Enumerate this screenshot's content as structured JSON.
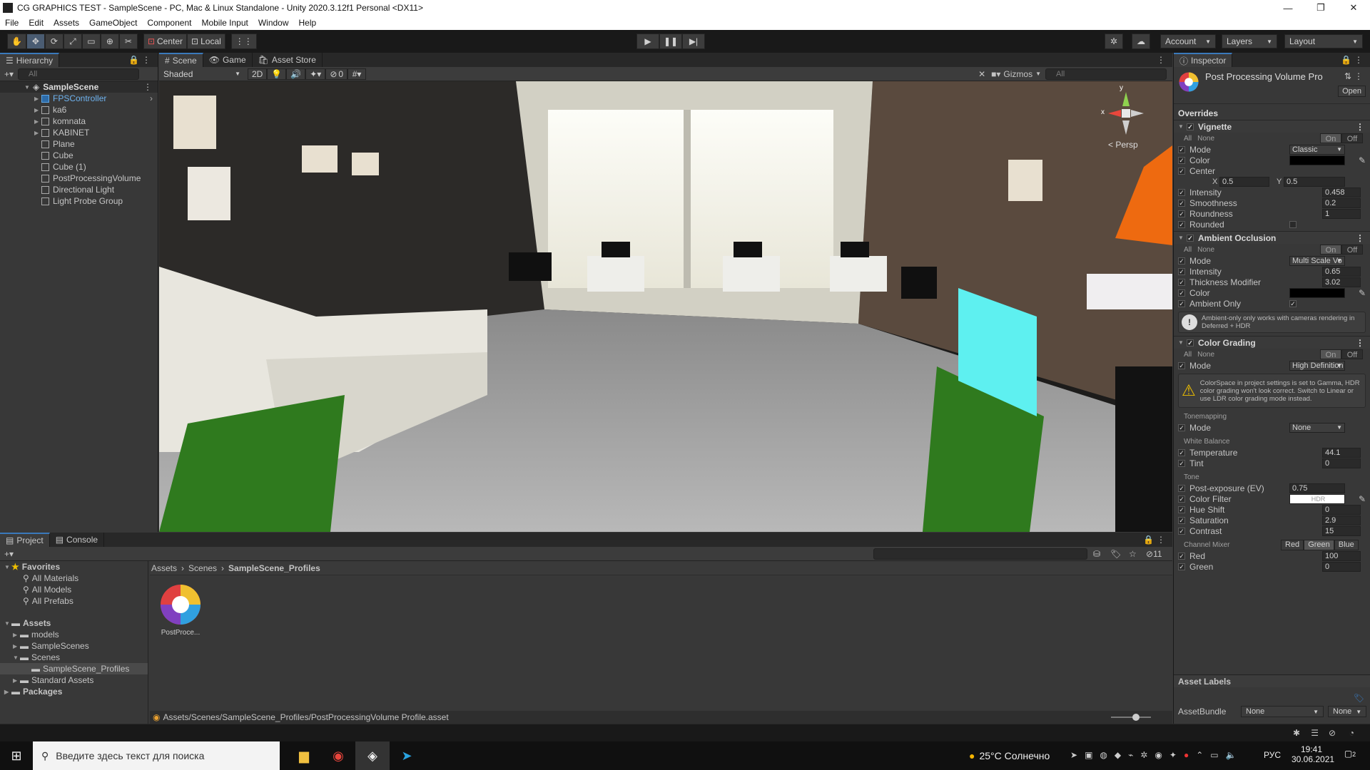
{
  "window": {
    "title": "CG GRAPHICS TEST - SampleScene - PC, Mac & Linux Standalone - Unity 2020.3.12f1 Personal <DX11>"
  },
  "menu": [
    "File",
    "Edit",
    "Assets",
    "GameObject",
    "Component",
    "Mobile Input",
    "Window",
    "Help"
  ],
  "toolbar": {
    "pivot": "Center",
    "space": "Local",
    "account": "Account",
    "layers": "Layers",
    "layout": "Layout"
  },
  "hierarchy": {
    "tab": "Hierarchy",
    "search": "All",
    "scene": "SampleScene",
    "items": [
      {
        "label": "FPSController",
        "prefab": true,
        "expand": true
      },
      {
        "label": "ka6",
        "expand": true
      },
      {
        "label": "komnata",
        "expand": true
      },
      {
        "label": "KABINET",
        "expand": true
      },
      {
        "label": "Plane"
      },
      {
        "label": "Cube"
      },
      {
        "label": "Cube (1)"
      },
      {
        "label": "PostProcessingVolume"
      },
      {
        "label": "Directional Light"
      },
      {
        "label": "Light Probe Group"
      }
    ]
  },
  "scene": {
    "tabs": [
      "Scene",
      "Game",
      "Asset Store"
    ],
    "shading": "Shaded",
    "mode2d": "2D",
    "hidden_count": "0",
    "gizmos": "Gizmos",
    "search": "All",
    "persp": "< Persp",
    "axis_x": "x",
    "axis_y": "y"
  },
  "project": {
    "tabs": [
      "Project",
      "Console"
    ],
    "favorites": "Favorites",
    "fav_items": [
      "All Materials",
      "All Models",
      "All Prefabs"
    ],
    "assets": "Assets",
    "asset_items": [
      "models",
      "SampleScenes",
      "Scenes"
    ],
    "scene_child": "SampleScene_Profiles",
    "other": [
      "Standard Assets"
    ],
    "packages": "Packages",
    "breadcrumb": [
      "Assets",
      "Scenes",
      "SampleScene_Profiles"
    ],
    "file": "PostProce...",
    "path": "Assets/Scenes/SampleScene_Profiles/PostProcessingVolume Profile.asset",
    "hidden_count": "11"
  },
  "inspector": {
    "tab": "Inspector",
    "title": "Post Processing Volume Pro",
    "open": "Open",
    "overrides": "Overrides",
    "all": "All",
    "none": "None",
    "on": "On",
    "off": "Off",
    "vignette": {
      "title": "Vignette",
      "mode_l": "Mode",
      "mode": "Classic",
      "color_l": "Color",
      "center_l": "Center",
      "x_l": "X",
      "x": "0.5",
      "y_l": "Y",
      "y": "0.5",
      "intensity_l": "Intensity",
      "intensity": "0.458",
      "smooth_l": "Smoothness",
      "smooth": "0.2",
      "round_l": "Roundness",
      "round": "1",
      "rounded_l": "Rounded"
    },
    "ao": {
      "title": "Ambient Occlusion",
      "mode_l": "Mode",
      "mode": "Multi Scale Vo",
      "intensity_l": "Intensity",
      "intensity": "0.65",
      "thick_l": "Thickness Modifier",
      "thick": "3.02",
      "color_l": "Color",
      "only_l": "Ambient Only",
      "info": "Ambient-only only works with cameras rendering in Deferred + HDR"
    },
    "cg": {
      "title": "Color Grading",
      "mode_l": "Mode",
      "mode": "High Definition",
      "warn": "ColorSpace in project settings is set to Gamma, HDR color grading won't look correct. Switch to Linear or use LDR color grading mode instead.",
      "tonemap": "Tonemapping",
      "tm_mode_l": "Mode",
      "tm_mode": "None",
      "wb": "White Balance",
      "temp_l": "Temperature",
      "temp": "44.1",
      "tint_l": "Tint",
      "tint": "0",
      "tone": "Tone",
      "post_l": "Post-exposure (EV)",
      "post": "0.75",
      "cf_l": "Color Filter",
      "cf": "HDR",
      "hue_l": "Hue Shift",
      "hue": "0",
      "sat_l": "Saturation",
      "sat": "2.9",
      "con_l": "Contrast",
      "con": "15",
      "mixer": "Channel Mixer",
      "red_b": "Red",
      "green_b": "Green",
      "blue_b": "Blue",
      "red_l": "Red",
      "red": "100",
      "green_l": "Green",
      "green": "0"
    },
    "labels": "Asset Labels",
    "bundle_l": "AssetBundle",
    "bundle": "None",
    "bundle2": "None"
  },
  "taskbar": {
    "search": "Введите здесь текст для поиска",
    "weather": "25°C Солнечно",
    "lang": "РУС",
    "time": "19:41",
    "date": "30.06.2021",
    "notif": "2"
  }
}
